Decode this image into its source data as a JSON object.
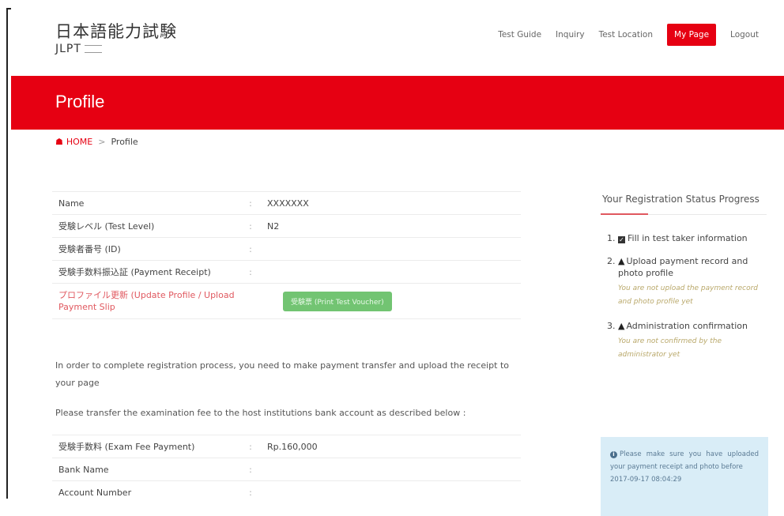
{
  "header": {
    "logo_jp": "日本語能力試験",
    "logo_en": "JLPT",
    "nav": [
      "Test Guide",
      "Inquiry",
      "Test Location",
      "My Page",
      "Logout"
    ]
  },
  "banner": {
    "title": "Profile"
  },
  "breadcrumb": {
    "home": "HOME",
    "separator": ">",
    "current": "Profile"
  },
  "profile": {
    "rows": [
      {
        "label": "Name",
        "sep": ":",
        "value": "XXXXXXX"
      },
      {
        "label": "受験レベル (Test Level)",
        "sep": ":",
        "value": "N2"
      },
      {
        "label": "受験者番号 (ID)",
        "sep": ":",
        "value": ""
      },
      {
        "label": "受験手数料振込証 (Payment Receipt)",
        "sep": ":",
        "value": ""
      }
    ],
    "update_link": "プロファイル更新 (Update Profile / Upload Payment Slip",
    "voucher_button": "受験票 (Print Test Voucher)"
  },
  "notes": {
    "line1": "In order to complete registration process, you need to make payment transfer and upload the receipt to your page",
    "line2": "Please transfer the examination fee to the host institutions bank account as described below :"
  },
  "fee": {
    "rows": [
      {
        "label": "受験手数料 (Exam Fee Payment)",
        "sep": ":",
        "value": "Rp.160,000"
      },
      {
        "label": "Bank Name",
        "sep": ":",
        "value": ""
      },
      {
        "label": "Account Number",
        "sep": ":",
        "value": ""
      }
    ]
  },
  "sidebar": {
    "title": "Your Registration Status Progress",
    "steps": [
      {
        "num": "1.",
        "text": "Fill in test taker information",
        "hint": ""
      },
      {
        "num": "2.",
        "text": "Upload payment record and photo profile",
        "hint": "You are not upload the payment record and photo profile yet"
      },
      {
        "num": "3.",
        "text": "Administration confirmation",
        "hint": "You are not confirmed by the administrator yet"
      }
    ],
    "info": "Please make sure you have uploaded your payment receipt and photo before",
    "info_date": "2017-09-17 08:04:29"
  },
  "colors": {
    "brand_red": "#e60012",
    "link_red": "#e0585f",
    "button_green": "#72c472",
    "info_bg": "#d9edf7"
  }
}
